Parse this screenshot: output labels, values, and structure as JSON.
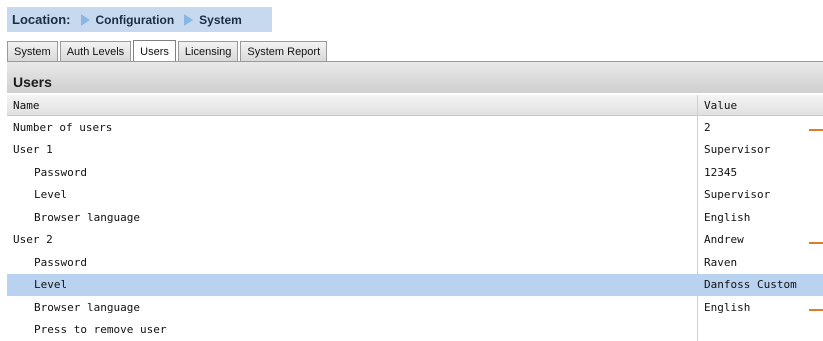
{
  "breadcrumb": {
    "location_label": "Location:",
    "items": [
      "Configuration",
      "System"
    ]
  },
  "tabs": [
    {
      "label": "System",
      "active": false
    },
    {
      "label": "Auth Levels",
      "active": false
    },
    {
      "label": "Users",
      "active": true
    },
    {
      "label": "Licensing",
      "active": false
    },
    {
      "label": "System Report",
      "active": false
    }
  ],
  "panel": {
    "title": "Users"
  },
  "grid": {
    "columns": {
      "name": "Name",
      "value": "Value"
    },
    "rows": [
      {
        "name": "Number of users",
        "value": "2"
      },
      {
        "name": "User 1",
        "value": "Supervisor"
      },
      {
        "name": "Password",
        "value": "12345"
      },
      {
        "name": "Level",
        "value": "Supervisor"
      },
      {
        "name": "Browser language",
        "value": "English"
      },
      {
        "name": "User 2",
        "value": "Andrew"
      },
      {
        "name": "Password",
        "value": "Raven"
      },
      {
        "name": "Level",
        "value": "Danfoss Custom",
        "selected": true
      },
      {
        "name": "Browser language",
        "value": "English"
      },
      {
        "name": "Press to remove user",
        "value": ""
      }
    ]
  },
  "colors": {
    "selected_row": "#b9d2ef",
    "breadcrumb_bg": "#c7d9ef",
    "change_marker": "#e07b28"
  }
}
